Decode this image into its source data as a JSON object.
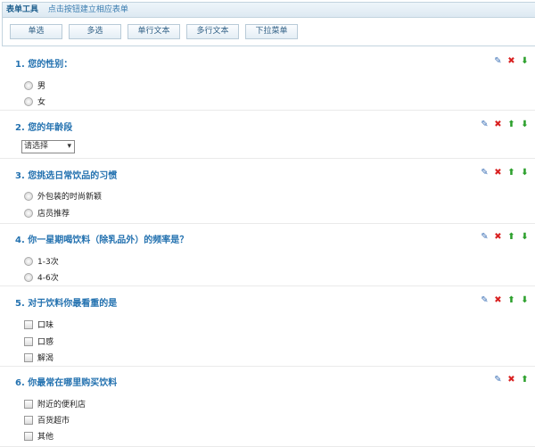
{
  "toolbar": {
    "title": "表单工具",
    "hint": "点击按钮建立相应表单",
    "buttons": [
      "单选",
      "多选",
      "单行文本",
      "多行文本",
      "下拉菜单"
    ]
  },
  "questions": [
    {
      "title": "1. 您的性别：",
      "type": "radio",
      "options": [
        "男",
        "女"
      ]
    },
    {
      "title": "2. 您的年龄段",
      "type": "select",
      "selected": "请选择"
    },
    {
      "title": "3. 您挑选日常饮品的习惯",
      "type": "radio",
      "options": [
        "外包装的时尚新颖",
        "店员推荐"
      ]
    },
    {
      "title": "4. 你一星期喝饮料（除乳品外）的频率是？",
      "type": "radio",
      "options": [
        "1-3次",
        "4-6次"
      ]
    },
    {
      "title": "5. 对于饮料你最看重的是",
      "type": "checkbox",
      "options": [
        "口味",
        "口感",
        "解渴"
      ]
    },
    {
      "title": "6. 你最常在哪里购买饮料",
      "type": "checkbox",
      "options": [
        "附近的便利店",
        "百货超市",
        "其他"
      ]
    }
  ],
  "icons": {
    "edit": "pencil-icon",
    "delete": "close-icon",
    "up": "arrow-up-icon",
    "down": "arrow-down-icon"
  }
}
